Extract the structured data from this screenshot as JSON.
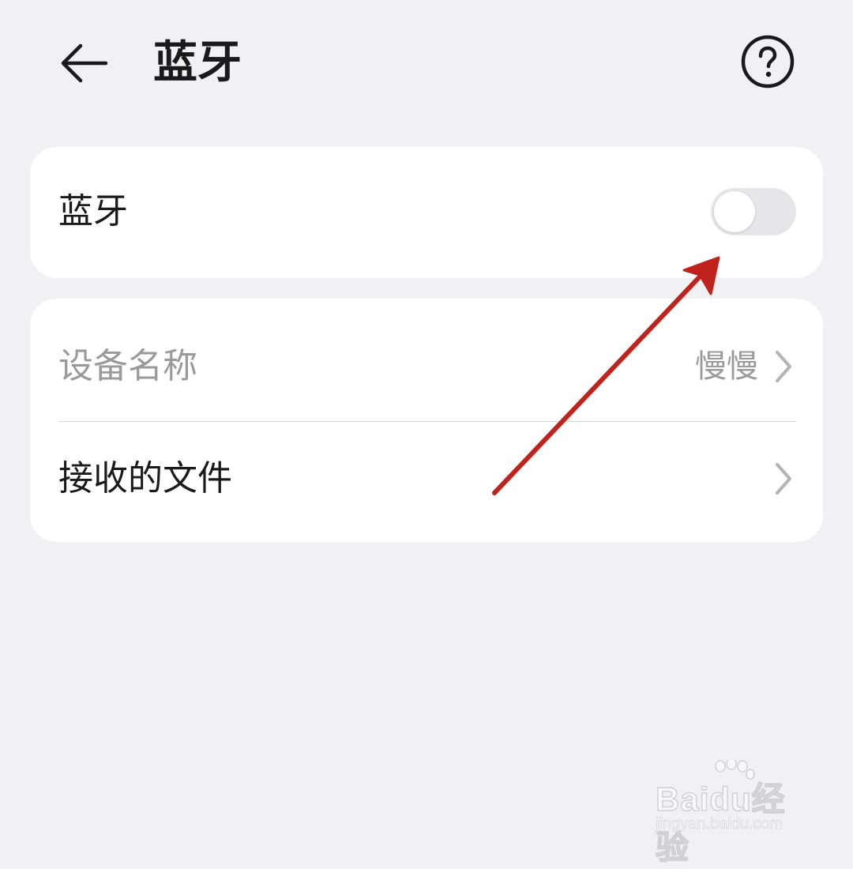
{
  "header": {
    "back_icon": "arrow-left-icon",
    "title": "蓝牙",
    "help_icon": "question-circle-icon"
  },
  "bluetooth_card": {
    "label": "蓝牙",
    "toggle_on": false
  },
  "settings_card": {
    "device_name": {
      "label": "设备名称",
      "value": "慢慢",
      "enabled": false
    },
    "received_files": {
      "label": "接收的文件"
    },
    "chevron_icon": "chevron-right-icon"
  },
  "colors": {
    "background": "#f1f1f3",
    "card": "#ffffff",
    "annotation_arrow": "#c0231c",
    "toggle_off": "#e6e6e8"
  },
  "watermark": {
    "brand": "Baidu经验",
    "url": "jingyan.baidu.com"
  }
}
